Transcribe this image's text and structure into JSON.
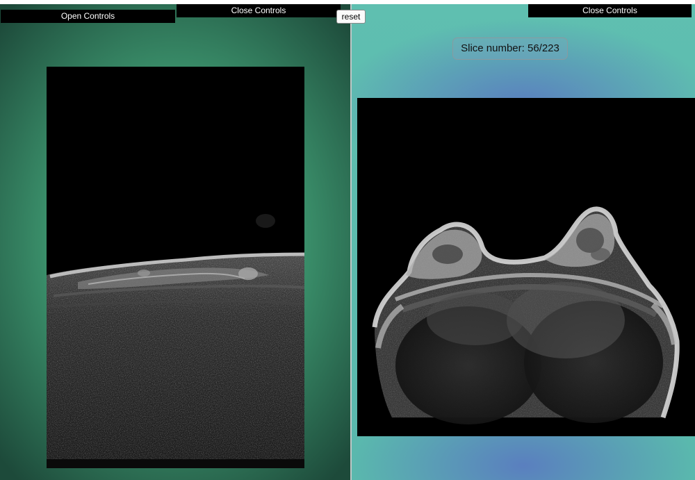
{
  "left_panel": {
    "open_controls_label": "Open Controls",
    "close_controls_label": "Close Controls",
    "view_icon": "mri-sagittal-slice"
  },
  "reset_button": {
    "label": "reset"
  },
  "right_panel": {
    "close_controls_label": "Close Controls",
    "slice_label": "Slice number: 56/223",
    "view_icon": "mri-axial-slice"
  },
  "colors": {
    "left_background": "#3f9a72",
    "right_background": "#5fbfb0",
    "control_bar": "#000000"
  }
}
